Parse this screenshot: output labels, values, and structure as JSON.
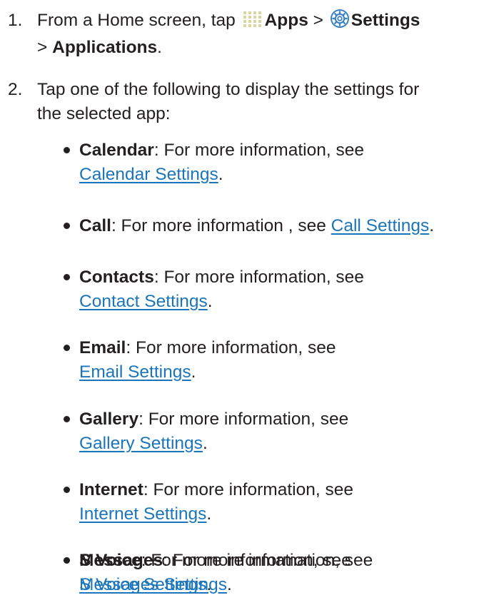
{
  "steps": [
    {
      "number": "1.",
      "prefix": "From a Home screen, tap",
      "apps_label": "Apps",
      "separator1": ">",
      "settings_label": "Settings",
      "separator2": ">",
      "applications_label": "Applications",
      "suffix": "."
    },
    {
      "number": "2.",
      "text": "Tap one of the following to display the settings for the selected app:"
    }
  ],
  "bullets": [
    {
      "term": "Calendar",
      "desc": ": For more information, see ",
      "link": "Calendar Settings",
      "end": "."
    },
    {
      "term": "Call",
      "desc": ": For more information , see ",
      "link": "Call Settings",
      "end": "."
    },
    {
      "term": "Contacts",
      "desc": ": For more information, see ",
      "link": "Contact Settings",
      "end": "."
    },
    {
      "term": "Email",
      "desc": ": For more information, see ",
      "link": "Email Settings",
      "end": "."
    },
    {
      "term": "Gallery",
      "desc": ": For more information, see ",
      "link": "Gallery Settings",
      "end": "."
    },
    {
      "term": "Internet",
      "desc": ": For more information, see ",
      "link": "Internet Settings",
      "end": "."
    },
    {
      "term": "Messages",
      "desc": ": For more information, see ",
      "link": "Messages Settings",
      "end": "."
    },
    {
      "term": "S Voice",
      "desc": ": For more information, see ",
      "link": "S Voice Settings",
      "end": "."
    }
  ],
  "icons": {
    "apps": "apps-grid-icon",
    "settings": "settings-gear-icon"
  },
  "colors": {
    "text": "#231f20",
    "link": "#1b75bb",
    "icon_blue": "#3b82c4",
    "icon_grid": "#d7d8a0"
  }
}
